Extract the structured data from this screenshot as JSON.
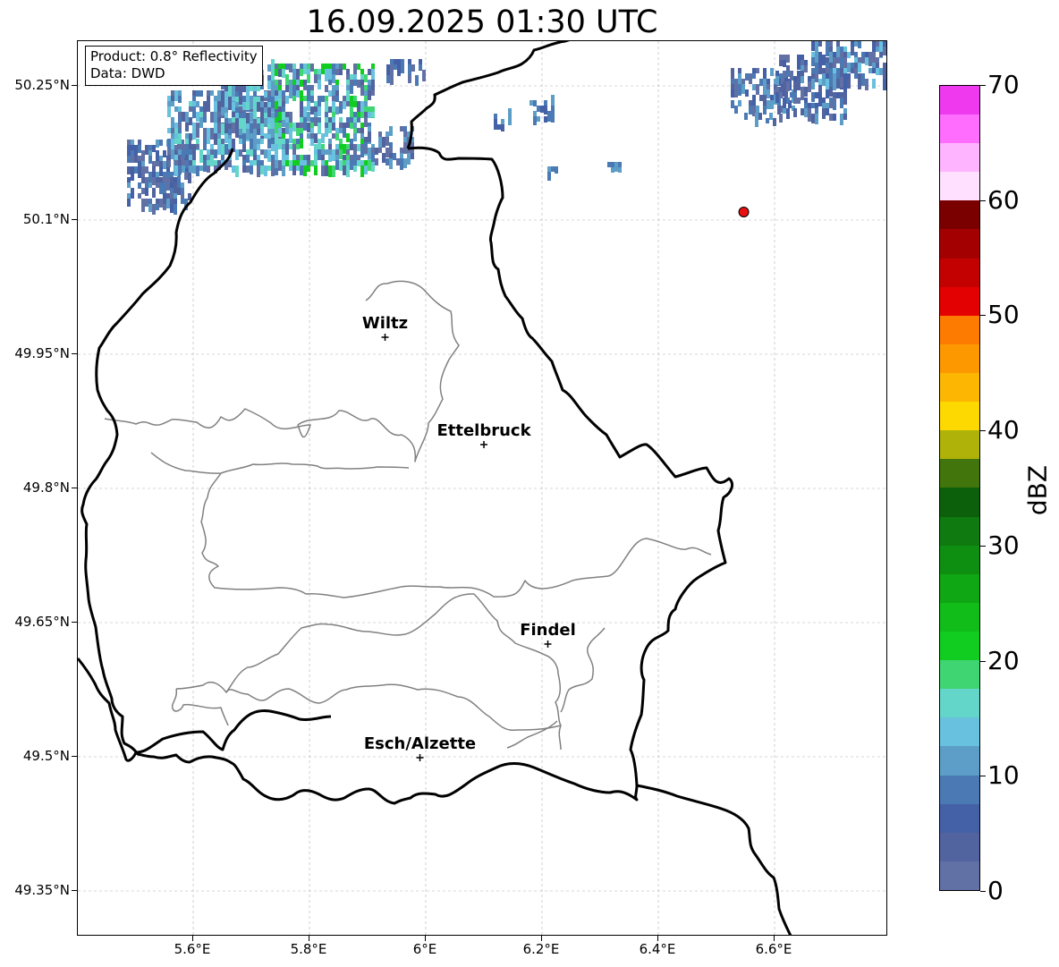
{
  "title": "16.09.2025 01:30 UTC",
  "info_box": {
    "product": "Product: 0.8° Reflectivity",
    "data": "Data: DWD"
  },
  "axes": {
    "lat_labels": [
      "50.25°N",
      "50.1°N",
      "49.95°N",
      "49.8°N",
      "49.65°N",
      "49.5°N",
      "49.35°N"
    ],
    "lat_values": [
      50.25,
      50.1,
      49.95,
      49.8,
      49.65,
      49.5,
      49.35
    ],
    "lon_labels": [
      "5.6°E",
      "5.8°E",
      "6°E",
      "6.2°E",
      "6.4°E",
      "6.6°E"
    ],
    "lon_values": [
      5.6,
      5.8,
      6.0,
      6.2,
      6.4,
      6.6
    ],
    "lat_range": [
      49.3,
      50.3
    ],
    "lon_range": [
      5.4,
      6.8
    ],
    "grid": true
  },
  "cities": [
    {
      "name": "Wiltz",
      "lon": 5.93,
      "lat": 49.969
    },
    {
      "name": "Ettelbruck",
      "lon": 6.1,
      "lat": 49.849
    },
    {
      "name": "Findel",
      "lon": 6.21,
      "lat": 49.626
    },
    {
      "name": "Esch/Alzette",
      "lon": 5.99,
      "lat": 49.499
    }
  ],
  "radar_site": {
    "lon": 6.547,
    "lat": 50.109,
    "color": "#e8100f"
  },
  "colorbar": {
    "unit": "dBZ",
    "min": 0,
    "max": 70,
    "tick_labels": [
      "0",
      "10",
      "20",
      "30",
      "40",
      "50",
      "60",
      "70"
    ],
    "tick_values": [
      0,
      10,
      20,
      30,
      40,
      50,
      60,
      70
    ],
    "colors": [
      "#6171a6",
      "#52649f",
      "#4460a6",
      "#4a79b4",
      "#5c9ec7",
      "#68c1de",
      "#63d6c9",
      "#3fd573",
      "#10cd1f",
      "#10bd19",
      "#10a714",
      "#0f8f12",
      "#0e7a10",
      "#0c600c",
      "#42750c",
      "#afb209",
      "#fed801",
      "#fdb703",
      "#fd9801",
      "#fd7b01",
      "#e30101",
      "#c30101",
      "#a30101",
      "#7a0000",
      "#ffe0ff",
      "#ffb4ff",
      "#ff6dff",
      "#ee39ee"
    ]
  },
  "colors": {
    "country_border": "#000000",
    "canton_border": "#808080",
    "grid": "#b0b0b0"
  }
}
